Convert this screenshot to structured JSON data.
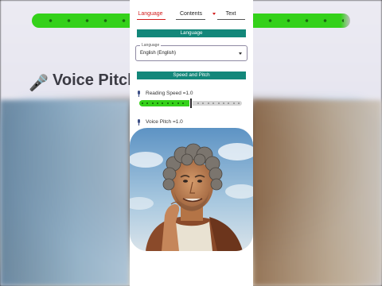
{
  "tabs": [
    {
      "label": "Language",
      "active": true
    },
    {
      "label": "Contents",
      "active": false
    },
    {
      "label": "Text",
      "active": false
    }
  ],
  "language_section": {
    "title": "Language"
  },
  "language_select": {
    "label": "Language",
    "value": "English (English)"
  },
  "speed_pitch_section": {
    "title": "Speed and Pitch"
  },
  "reading_speed": {
    "label": "Reading Speed =1.0",
    "value": 1.0,
    "fraction": 0.5,
    "icon": "mic-icon"
  },
  "voice_pitch": {
    "label": "Voice Pitch =1.0",
    "value": 1.0,
    "icon": "mic-icon"
  },
  "background": {
    "title": "Voice Pitch"
  },
  "colors": {
    "accent": "#13877a",
    "active_tab": "#d21b1b",
    "slider_on": "#34d11a",
    "slider_off": "#d6d6d6"
  }
}
